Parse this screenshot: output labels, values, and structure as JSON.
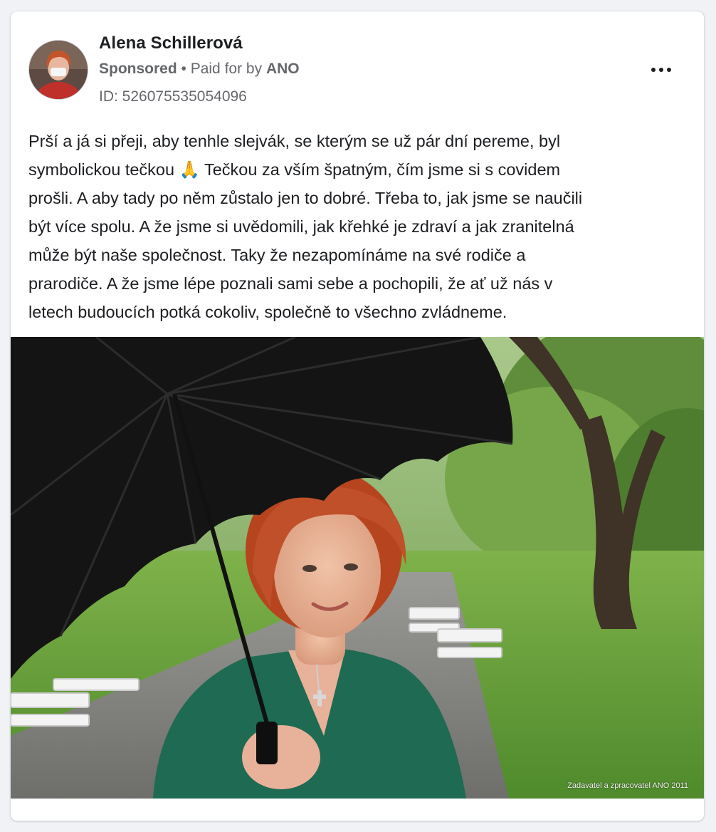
{
  "post": {
    "page_name": "Alena Schillerová",
    "sponsored_label": "Sponsored",
    "paid_for_prefix": " • Paid for by ",
    "payer": "ANO",
    "ad_id": "ID: 526075535054096",
    "more_icon": "more-horizontal-icon",
    "text_lines": [
      "Prší a já si přeji, aby tenhle slejvák, se kterým se už pár dní pereme, byl",
      "symbolickou tečkou 🙏 Tečkou za vším špatným, čím jsme si s covidem",
      "prošli. A aby tady po něm zůstalo jen to dobré. Třeba to, jak jsme se naučili",
      "být více spolu. A že jsme si uvědomili, jak křehké je zdraví a jak zranitelná",
      "může být naše společnost. Taky že nezapomínáme na své rodiče a",
      "prarodiče. A že jsme lépe poznali sami sebe a pochopili, že ať už nás v",
      "letech budoucích potká cokoliv, společně to všechno zvládneme."
    ],
    "image_credit": "Zadavatel a zpracovatel ANO 2011"
  },
  "colors": {
    "text_primary": "#1c1e21",
    "text_secondary": "#65676b",
    "card_bg": "#ffffff",
    "page_bg": "#f0f2f5"
  }
}
